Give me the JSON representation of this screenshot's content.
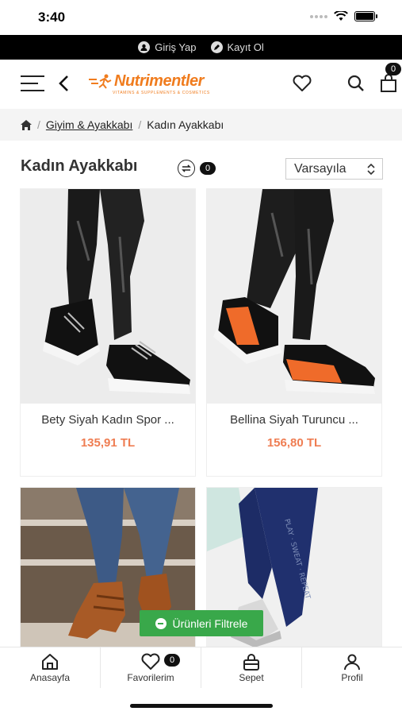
{
  "status": {
    "time": "3:40"
  },
  "topbar": {
    "login": "Giriş Yap",
    "register": "Kayıt Ol"
  },
  "header": {
    "logo": "Nutrimentler",
    "logo_sub": "VITAMINS & SUPPLEMENTS & COSMETICS",
    "cart_count": "0"
  },
  "breadcrumb": {
    "category": "Giyim & Ayakkabı",
    "current": "Kadın Ayakkabı"
  },
  "page": {
    "title": "Kadın Ayakkabı",
    "count": "0",
    "sort": "Varsayıla"
  },
  "products": [
    {
      "name": "Bety Siyah Kadın Spor ...",
      "price": "135,91 TL"
    },
    {
      "name": "Bellina Siyah Turuncu ...",
      "price": "156,80 TL"
    },
    {
      "name": "",
      "price": ""
    },
    {
      "name": "",
      "price": ""
    }
  ],
  "filter": {
    "label": "Ürünleri Filtrele"
  },
  "nav": {
    "home": "Anasayfa",
    "favorites": "Favorilerim",
    "favorites_count": "0",
    "cart": "Sepet",
    "profile": "Profil"
  },
  "colors": {
    "accent": "#f07c1e",
    "price": "#ef7d52",
    "filter": "#39a84a"
  }
}
